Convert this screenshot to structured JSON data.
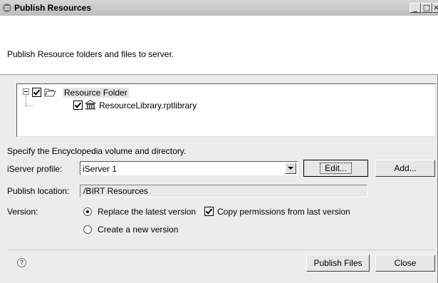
{
  "window": {
    "title": "Publish Resources",
    "controls": [
      "_",
      "□",
      "×"
    ]
  },
  "header": {
    "description": "Publish Resource folders and files to server."
  },
  "tree": {
    "root": {
      "label": "Resource Folder",
      "checked": true,
      "expanded": true,
      "icon": "folder-open-icon"
    },
    "children": [
      {
        "label": "ResourceLibrary.rptlibrary",
        "checked": true,
        "icon": "library-icon"
      }
    ]
  },
  "encyclopedia": {
    "instructions": "Specify the Encyclopedia volume and directory.",
    "profile_label": "iServer profile:",
    "profile_value": "iServer 1",
    "edit_label": "Edit...",
    "add_label": "Add...",
    "location_label": "Publish location:",
    "location_value": "/BIRT Resources"
  },
  "version": {
    "label": "Version:",
    "replace_label": "Replace the latest version",
    "replace_selected": true,
    "create_label": "Create a new version",
    "create_selected": false,
    "copy_permissions_label": "Copy permissions from last version",
    "copy_permissions_checked": true
  },
  "footer": {
    "help_glyph": "?",
    "publish_label": "Publish Files",
    "close_label": "Close"
  }
}
